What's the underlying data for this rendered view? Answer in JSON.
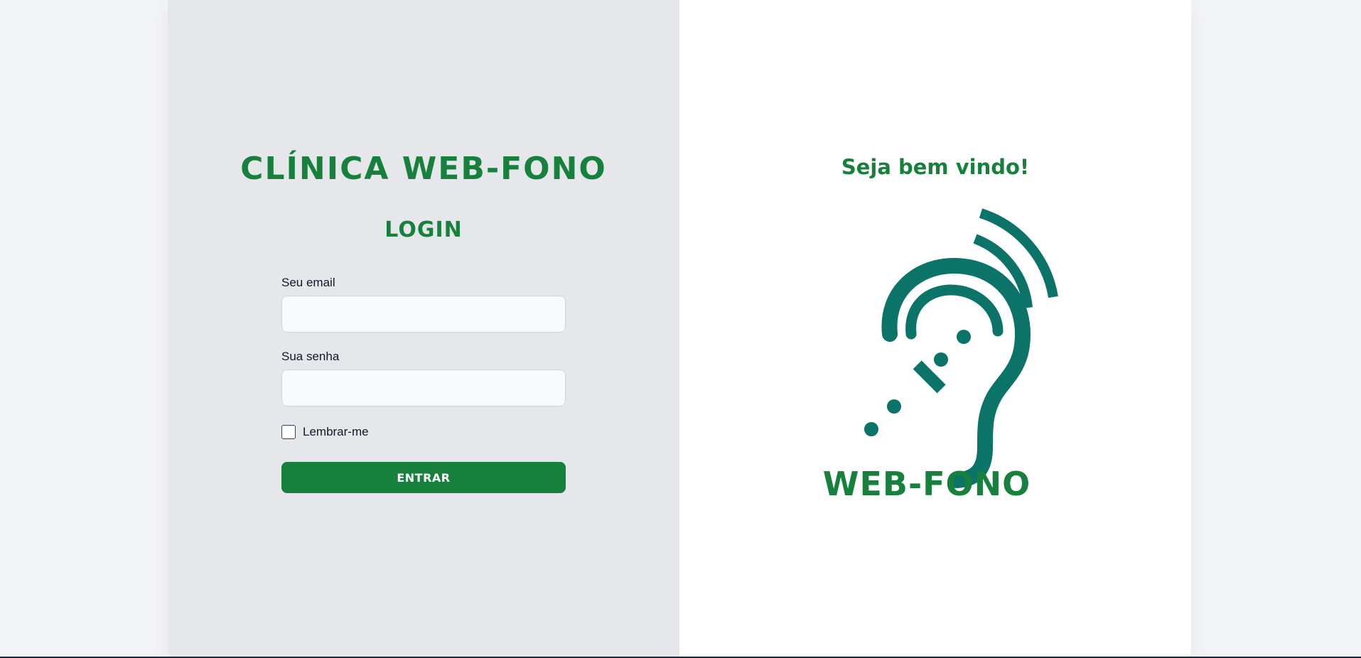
{
  "left": {
    "clinic_title": "CLÍNICA WEB-FONO",
    "login_title": "LOGIN",
    "email_label": "Seu email",
    "email_value": "",
    "password_label": "Sua senha",
    "password_value": "",
    "remember_label": "Lembrar-me",
    "remember_checked": false,
    "submit_label": "ENTRAR"
  },
  "right": {
    "welcome": "Seja bem vindo!",
    "logo_icon": "ear-with-sound-waves-icon",
    "logo_text": "WEB-FONO"
  },
  "colors": {
    "brand_green": "#16803c",
    "logo_teal": "#0b7367",
    "left_panel_bg": "#e5e7eb",
    "right_panel_bg": "#ffffff",
    "page_bg": "#f3f4f6"
  }
}
